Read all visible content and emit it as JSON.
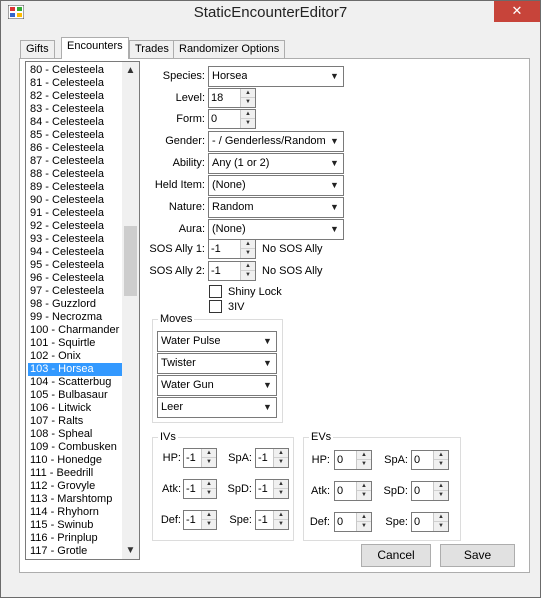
{
  "window": {
    "title": "StaticEncounterEditor7",
    "close_symbol": "✕"
  },
  "tabs": [
    {
      "label": "Gifts",
      "active": false
    },
    {
      "label": "Encounters",
      "active": true
    },
    {
      "label": "Trades",
      "active": false
    },
    {
      "label": "Randomizer Options",
      "active": false
    }
  ],
  "encounter_list": {
    "items": [
      "80 - Celesteela",
      "81 - Celesteela",
      "82 - Celesteela",
      "83 - Celesteela",
      "84 - Celesteela",
      "85 - Celesteela",
      "86 - Celesteela",
      "87 - Celesteela",
      "88 - Celesteela",
      "89 - Celesteela",
      "90 - Celesteela",
      "91 - Celesteela",
      "92 - Celesteela",
      "93 - Celesteela",
      "94 - Celesteela",
      "95 - Celesteela",
      "96 - Celesteela",
      "97 - Celesteela",
      "98 - Guzzlord",
      "99 - Necrozma",
      "100 - Charmander",
      "101 - Squirtle",
      "102 - Onix",
      "103 - Horsea",
      "104 - Scatterbug",
      "105 - Bulbasaur",
      "106 - Litwick",
      "107 - Ralts",
      "108 - Spheal",
      "109 - Combusken",
      "110 - Honedge",
      "111 - Beedrill",
      "112 - Grovyle",
      "113 - Marshtomp",
      "114 - Rhyhorn",
      "115 - Swinub",
      "116 - Prinplup",
      "117 - Grotle"
    ],
    "selected_index": 23,
    "scroll_up": "▲",
    "scroll_down": "▼"
  },
  "form": {
    "species": {
      "label": "Species:",
      "value": "Horsea"
    },
    "level": {
      "label": "Level:",
      "value": "18"
    },
    "form": {
      "label": "Form:",
      "value": "0"
    },
    "gender": {
      "label": "Gender:",
      "value": "- / Genderless/Random"
    },
    "ability": {
      "label": "Ability:",
      "value": "Any (1 or 2)"
    },
    "held_item": {
      "label": "Held Item:",
      "value": "(None)"
    },
    "nature": {
      "label": "Nature:",
      "value": "Random"
    },
    "aura": {
      "label": "Aura:",
      "value": "(None)"
    },
    "sos_ally_1": {
      "label": "SOS Ally 1:",
      "value": "-1",
      "status": "No SOS Ally"
    },
    "sos_ally_2": {
      "label": "SOS Ally 2:",
      "value": "-1",
      "status": "No SOS Ally"
    },
    "shiny_lock": {
      "label": "Shiny Lock",
      "checked": false
    },
    "three_iv": {
      "label": "3IV",
      "checked": false
    }
  },
  "moves": {
    "title": "Moves",
    "items": [
      "Water Pulse",
      "Twister",
      "Water Gun",
      "Leer"
    ]
  },
  "ivs": {
    "title": "IVs",
    "hp": {
      "label": "HP:",
      "value": "-1"
    },
    "atk": {
      "label": "Atk:",
      "value": "-1"
    },
    "def": {
      "label": "Def:",
      "value": "-1"
    },
    "spa": {
      "label": "SpA:",
      "value": "-1"
    },
    "spd": {
      "label": "SpD:",
      "value": "-1"
    },
    "spe": {
      "label": "Spe:",
      "value": "-1"
    }
  },
  "evs": {
    "title": "EVs",
    "hp": {
      "label": "HP:",
      "value": "0"
    },
    "atk": {
      "label": "Atk:",
      "value": "0"
    },
    "def": {
      "label": "Def:",
      "value": "0"
    },
    "spa": {
      "label": "SpA:",
      "value": "0"
    },
    "spd": {
      "label": "SpD:",
      "value": "0"
    },
    "spe": {
      "label": "Spe:",
      "value": "0"
    }
  },
  "buttons": {
    "cancel": "Cancel",
    "save": "Save"
  },
  "icons": {
    "dropdown_arrow": "▼",
    "spin_up": "▲",
    "spin_down": "▼"
  }
}
